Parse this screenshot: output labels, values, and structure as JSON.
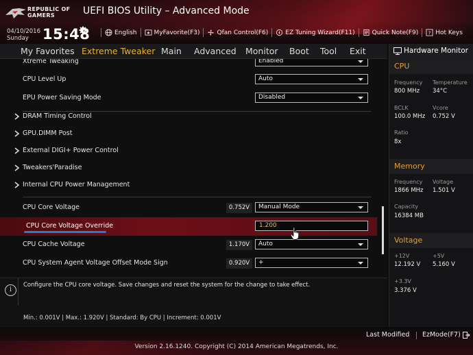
{
  "header": {
    "brand_line1": "REPUBLIC OF",
    "brand_line2": "GAMERS",
    "title": "UEFI BIOS Utility – Advanced Mode",
    "date": "04/10/2016",
    "day": "Sunday",
    "time": "15:48",
    "toolbar": {
      "language": "English",
      "myfavorite": "MyFavorite(F3)",
      "qfan": "Qfan Control(F6)",
      "ez_tuning": "EZ Tuning Wizard(F11)",
      "quick_note": "Quick Note(F9)",
      "hot_keys": "Hot Keys"
    }
  },
  "nav": {
    "tabs": [
      "My Favorites",
      "Extreme Tweaker",
      "Main",
      "Advanced",
      "Monitor",
      "Boot",
      "Tool",
      "Exit"
    ],
    "active": "Extreme Tweaker"
  },
  "main": {
    "xtreme_tweaking": {
      "label": "Xtreme Tweaking",
      "value": "Enabled"
    },
    "cpu_level_up": {
      "label": "CPU Level Up",
      "value": "Auto"
    },
    "epu_power": {
      "label": "EPU Power Saving Mode",
      "value": "Disabled"
    },
    "submenus": [
      "DRAM Timing Control",
      "GPU.DIMM Post",
      "External DIGI+ Power Control",
      "Tweakers'Paradise",
      "Internal CPU Power Management"
    ],
    "cpu_core_voltage": {
      "label": "CPU Core Voltage",
      "reading": "0.752V",
      "value": "Manual Mode"
    },
    "cpu_core_voltage_override": {
      "label": "CPU Core Voltage Override",
      "value": "1.200"
    },
    "cpu_cache_voltage": {
      "label": "CPU Cache Voltage",
      "reading": "1.170V",
      "value": "Auto"
    },
    "cpu_sa_offset": {
      "label": "CPU System Agent Voltage Offset Mode Sign",
      "reading": "0.920V",
      "value": "+"
    }
  },
  "info": {
    "description": "Configure the CPU core voltage. Save changes and reset the system for the change to take effect.",
    "limits": "Min.: 0.001V   |   Max.: 1.920V   |   Standard: By CPU   |   Increment: 0.001V"
  },
  "hw_monitor": {
    "title": "Hardware Monitor",
    "cpu": {
      "section": "CPU",
      "frequency_label": "Frequency",
      "frequency": "800 MHz",
      "temperature_label": "Temperature",
      "temperature": "34°C",
      "bclk_label": "BCLK",
      "bclk": "100.0 MHz",
      "vcore_label": "Vcore",
      "vcore": "0.752 V",
      "ratio_label": "Ratio",
      "ratio": "8x"
    },
    "memory": {
      "section": "Memory",
      "frequency_label": "Frequency",
      "frequency": "1866 MHz",
      "voltage_label": "Voltage",
      "voltage": "1.501 V",
      "capacity_label": "Capacity",
      "capacity": "16384 MB"
    },
    "voltage": {
      "section": "Voltage",
      "v12_label": "+12V",
      "v12": "12.192 V",
      "v5_label": "+5V",
      "v5": "5.160 V",
      "v33_label": "+3.3V",
      "v33": "3.376 V"
    }
  },
  "footer": {
    "last_modified": "Last Modified",
    "ezmode": "EzMode(F7)",
    "copyright": "Version 2.16.1240. Copyright (C) 2014 American Megatrends, Inc."
  },
  "colors": {
    "accent_orange": "#e8b030",
    "highlight_red": "#6d0f17",
    "selection_underline": "#1e7fd6"
  }
}
